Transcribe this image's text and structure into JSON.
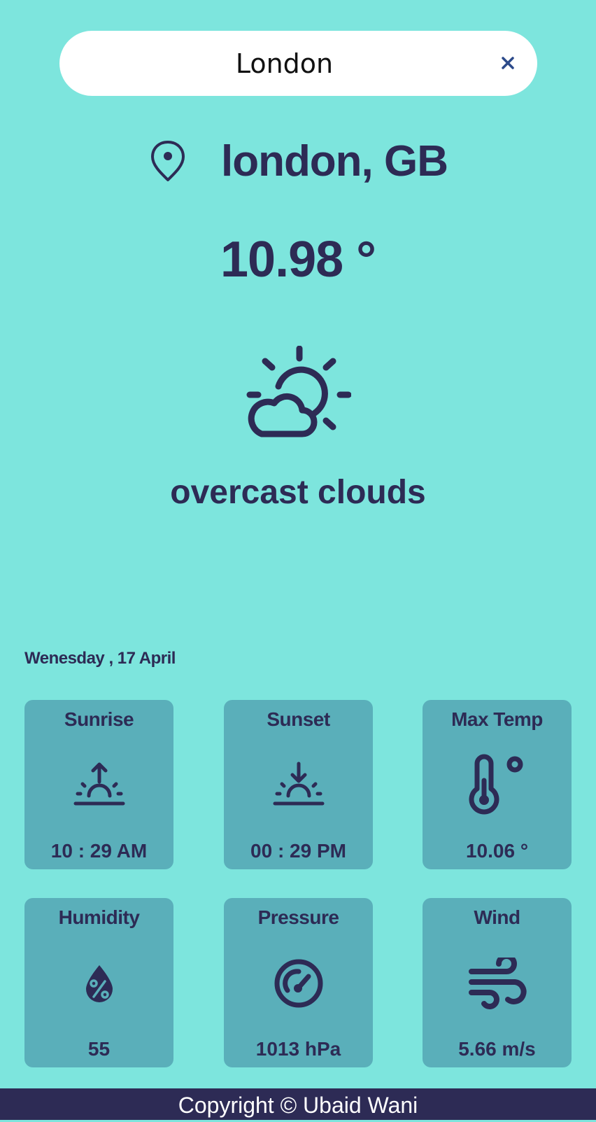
{
  "search": {
    "value": "London",
    "clear_glyph": "×"
  },
  "location": {
    "icon": "location-pin-icon",
    "city": "london, GB"
  },
  "current": {
    "temperature": "10.98 °",
    "icon": "sun-behind-cloud-icon",
    "description": "overcast clouds"
  },
  "date": "Wenesday , 17 April",
  "cards": [
    {
      "title": "Sunrise",
      "icon": "sunrise-icon",
      "value": "10 : 29 AM"
    },
    {
      "title": "Sunset",
      "icon": "sunset-icon",
      "value": "00 : 29 PM"
    },
    {
      "title": "Max Temp",
      "icon": "thermometer-icon",
      "value": "10.06 °"
    },
    {
      "title": "Humidity",
      "icon": "humidity-drop-icon",
      "value": "55"
    },
    {
      "title": "Pressure",
      "icon": "gauge-icon",
      "value": "1013 hPa"
    },
    {
      "title": "Wind",
      "icon": "wind-icon",
      "value": "5.66 m/s"
    }
  ],
  "footer": {
    "text": "Copyright © Ubaid Wani"
  },
  "colors": {
    "background": "#7de5dd",
    "text": "#2d2b55",
    "card": "#5aafba",
    "footer": "#2d2b55"
  }
}
